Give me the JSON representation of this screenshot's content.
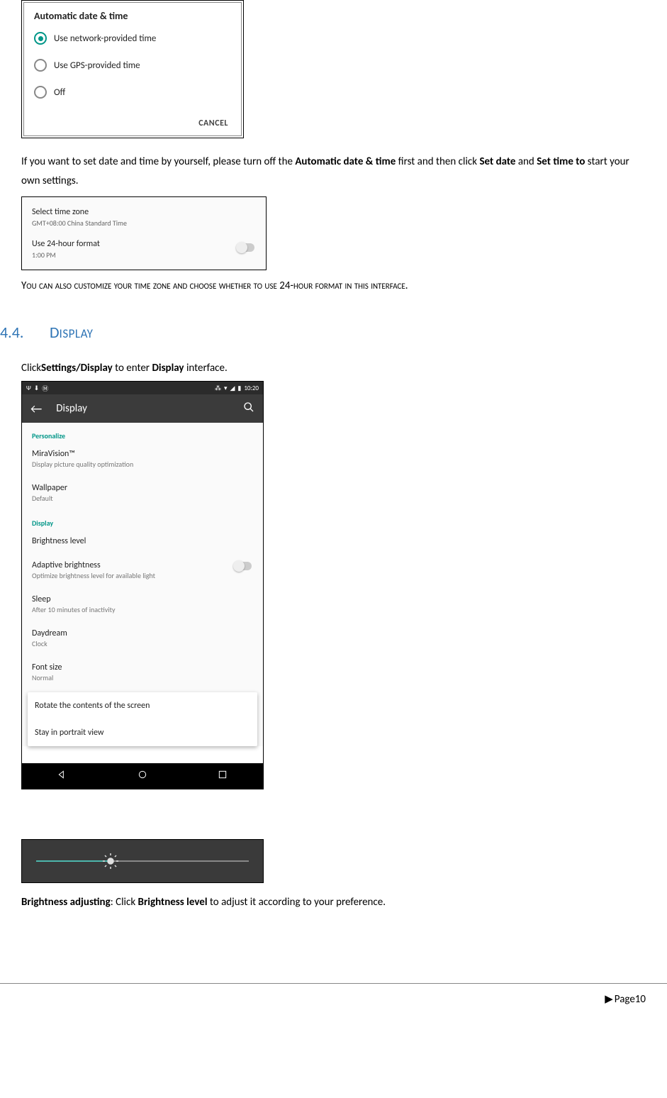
{
  "dialog": {
    "title": "Automatic date & time",
    "options": [
      "Use network-provided time",
      "Use GPS-provided time",
      "Off"
    ],
    "cancel": "CANCEL"
  },
  "para1": {
    "t1": "If you want to set date and time by yourself, please turn off the ",
    "b1": "Automatic date & time",
    "t2": " first and then click ",
    "b2": "Set date",
    "t3": " and ",
    "b3": "Set time to",
    "t4": " start your own settings."
  },
  "shot2": {
    "tz_title": "Select time zone",
    "tz_sub": "GMT+08:00 China Standard Time",
    "fmt_title": "Use 24-hour format",
    "fmt_sub": "1:00 PM"
  },
  "para2": "You can also customize your time zone and choose whether to use 24-hour format in this interface.",
  "section": {
    "number": "4.4.",
    "title_first": "D",
    "title_rest": "ISPLAY"
  },
  "para3": {
    "t1": "Click",
    "b1": "Settings/Display",
    "t2": " to enter ",
    "b2": "Display",
    "t3": " interface."
  },
  "display": {
    "time": "10:20",
    "appbar_title": "Display",
    "cat1": "Personalize",
    "miravision": "MiraVision™",
    "miravision_sub": "Display picture quality optimization",
    "wallpaper": "Wallpaper",
    "wallpaper_sub": "Default",
    "cat2": "Display",
    "brightness": "Brightness level",
    "adaptive": "Adaptive brightness",
    "adaptive_sub": "Optimize brightness level for available light",
    "sleep": "Sleep",
    "sleep_sub": "After 10 minutes of inactivity",
    "daydream": "Daydream",
    "daydream_sub": "Clock",
    "fontsize": "Font size",
    "fontsize_sub": "Normal",
    "popup1": "Rotate the contents of the screen",
    "popup2": "Stay in portrait view"
  },
  "para4": {
    "b1": "Brightness adjusting",
    "t1": ": Click ",
    "b2": "Brightness level",
    "t2": " to adjust it according to your preference."
  },
  "footer": {
    "label": "Page",
    "num": "10"
  }
}
